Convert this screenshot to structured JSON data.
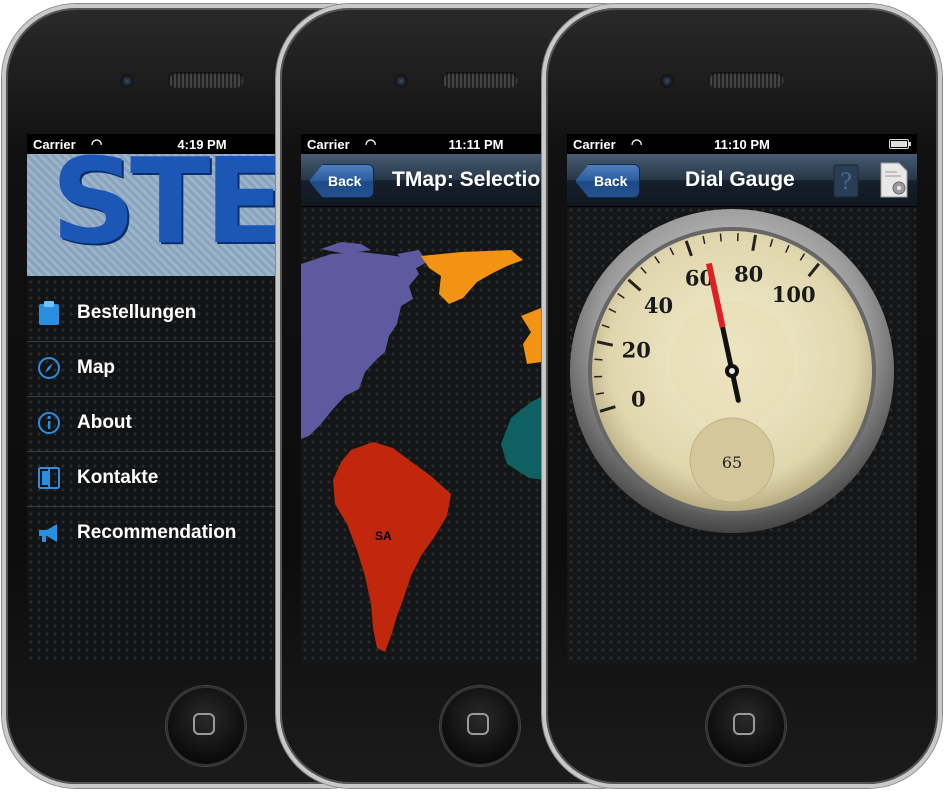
{
  "phone1": {
    "status": {
      "carrier": "Carrier",
      "time": "4:19 PM"
    },
    "banner_text": "STEA",
    "menu": [
      {
        "label": "Bestellungen",
        "icon": "clipboard-icon"
      },
      {
        "label": "Map",
        "icon": "compass-icon"
      },
      {
        "label": "About",
        "icon": "info-icon"
      },
      {
        "label": "Kontakte",
        "icon": "address-book-icon"
      },
      {
        "label": "Recommendation",
        "icon": "megaphone-icon"
      }
    ]
  },
  "phone2": {
    "status": {
      "carrier": "Carrier",
      "time": "11:11 PM"
    },
    "back_label": "Back",
    "title": "TMap: Selection",
    "region_label": "SA",
    "colors": {
      "north_america": "#5d5aa0",
      "greenland": "#f39314",
      "south_america": "#c0270c",
      "africa": "#0f6060",
      "europe": "#f39314"
    }
  },
  "phone3": {
    "status": {
      "carrier": "Carrier",
      "time": "11:10 PM"
    },
    "back_label": "Back",
    "title": "Dial Gauge",
    "gauge": {
      "min": 0,
      "max": 100,
      "value": 65,
      "value_label": "65",
      "tick_labels": [
        "0",
        "20",
        "40",
        "60",
        "80",
        "100"
      ],
      "needle_color": "#e02020"
    },
    "icons": [
      "help-icon",
      "settings-document-icon"
    ]
  }
}
